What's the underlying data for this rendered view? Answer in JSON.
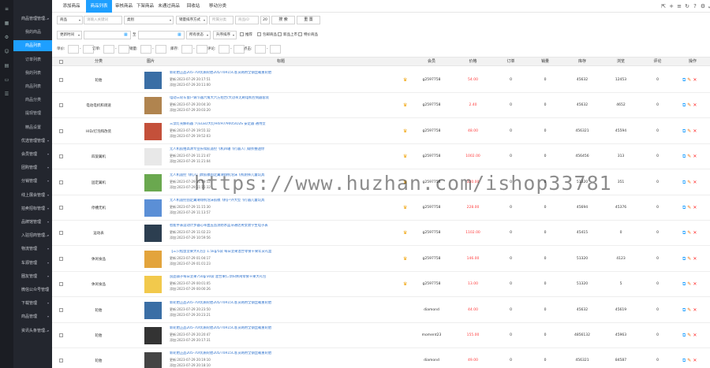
{
  "app": {
    "title": "商品列表"
  },
  "sidebar": {
    "icons": [
      "menu-icon",
      "grid-icon",
      "gear-icon",
      "user-icon",
      "chart-icon",
      "folder-icon",
      "list-icon"
    ],
    "items": [
      {
        "label": "商品管理管理...",
        "sub": false,
        "arrow": true
      },
      {
        "label": "我的商品",
        "sub": true
      },
      {
        "label": "商品列表",
        "sub": true,
        "active": true
      },
      {
        "label": "订单列表",
        "sub": true
      },
      {
        "label": "我的列表",
        "sub": true
      },
      {
        "label": "商品列表",
        "sub": true
      },
      {
        "label": "商品分类",
        "sub": true
      },
      {
        "label": "提现管理",
        "sub": true
      },
      {
        "label": "精品设置",
        "sub": true
      },
      {
        "label": "优选管理管理",
        "sub": false,
        "arrow": true
      },
      {
        "label": "会员管理",
        "sub": false,
        "arrow": true
      },
      {
        "label": "团购管理",
        "sub": false,
        "arrow": true
      },
      {
        "label": "分销管理",
        "sub": false,
        "arrow": true
      },
      {
        "label": "线上展会管理",
        "sub": false,
        "arrow": true
      },
      {
        "label": "拍卖招标管理",
        "sub": false,
        "arrow": true
      },
      {
        "label": "品牌馆管理",
        "sub": false,
        "arrow": true
      },
      {
        "label": "入驻招商管理...",
        "sub": false,
        "arrow": true
      },
      {
        "label": "物流管理",
        "sub": false,
        "arrow": true
      },
      {
        "label": "车源管理",
        "sub": false,
        "arrow": true
      },
      {
        "label": "圈友管理",
        "sub": false,
        "arrow": true
      },
      {
        "label": "微信公众号管理",
        "sub": false,
        "arrow": true
      },
      {
        "label": "下载管理",
        "sub": false,
        "arrow": true
      },
      {
        "label": "商品管理",
        "sub": false,
        "arrow": true
      },
      {
        "label": "资讯头条管理...",
        "sub": false,
        "arrow": true
      }
    ]
  },
  "tabs": [
    {
      "label": "添加商品",
      "active": false
    },
    {
      "label": "商品列表",
      "active": true
    },
    {
      "label": "审核商品",
      "active": false
    },
    {
      "label": "下架商品",
      "active": false
    },
    {
      "label": "未通过商品",
      "active": false
    },
    {
      "label": "回收站",
      "active": false
    },
    {
      "label": "移动分类",
      "active": false
    }
  ],
  "toolbar_icons": [
    "expand-icon",
    "add-icon",
    "list-icon",
    "refresh-icon",
    "help-icon",
    "settings-icon",
    "fullscreen-icon"
  ],
  "filters": {
    "row1": {
      "field_select": "商品",
      "keyword_placeholder": "请输入关键词",
      "type_select": "类别",
      "sort_select": "销量排序方式",
      "category_placeholder": "所属分类",
      "sub_placeholder": "商品ID",
      "page_size": "20",
      "search_button": "搜 索",
      "reset_button": "重 置"
    },
    "row2": {
      "time_select": "更新时间",
      "to_label": "至",
      "status_select": "所有状态",
      "order_select": "升序排序",
      "checkboxes": [
        "推荐",
        "包邮商品",
        "新品上市",
        "特价商品"
      ]
    },
    "row3": {
      "labels": [
        "单价:",
        "订单:",
        "销量:",
        "库存:",
        "评论:",
        "点击:"
      ],
      "dash": "-"
    }
  },
  "table": {
    "headers": [
      "",
      "分类",
      "",
      "图片",
      "标题",
      "",
      "会员",
      "价格",
      "订单",
      "销量",
      "库存",
      "浏览",
      "评论",
      "操作"
    ],
    "rows": [
      {
        "category": "轮胎",
        "title": "新轮胎正品205-70/优质轮胎205/70R15C客货两用全钢丝载重轮胎",
        "updated": "更新:2023-07-29 20:17:51",
        "added": "添加:2023-07-29 20:11:00",
        "member": "g2597758",
        "price": "54.00",
        "orders": "0",
        "sales": "0",
        "stock": "45632",
        "views": "12453",
        "comments": "0",
        "thumb": "#3a6ea5",
        "vip": true
      },
      {
        "category": "电动电机和调速",
        "title": "电动三轮车窗户调节器六角大六方组合/大功率无刷电机控制器套装",
        "updated": "更新:2023-07-29 20:04:30",
        "added": "添加:2023-07-29 20:03:20",
        "member": "g2597758",
        "price": "2.40",
        "orders": "0",
        "sales": "0",
        "stock": "45632",
        "views": "4652",
        "comments": "0",
        "thumb": "#b0844f",
        "vip": true
      },
      {
        "category": "HID/灯泡和改装",
        "title": "三漂灯光解码器 汽车LED大灯H4/H7/9005/D2S 安定器 通用型",
        "updated": "更新:2023-07-29 19:55:32",
        "added": "添加:2023-07-29 19:52:03",
        "member": "g2597758",
        "price": "48.00",
        "orders": "0",
        "sales": "0",
        "stock": "456321",
        "views": "45594",
        "comments": "0",
        "thumb": "#c4503a",
        "vip": true
      },
      {
        "category": "四旋翼机",
        "title": "无人机航拍高清专业长续航遥控飞机四轴飞行器入门级折叠迷你",
        "updated": "更新:2023-07-29 11:21:47",
        "added": "添加:2023-07-29 11:21:04",
        "member": "g2597758",
        "price": "1002.00",
        "orders": "0",
        "sales": "0",
        "stock": "456456",
        "views": "313",
        "comments": "0",
        "thumb": "#e8e8e8",
        "vip": true
      },
      {
        "category": "固定翼机",
        "title": "无人机遥控飞机入门款航模固定翼滑翔机泡沫飞机耐摔儿童玩具",
        "updated": "更新:2023-07-29 11:19:52",
        "added": "添加:2023-07-29 11:15:32",
        "member": "g2597758",
        "price": "320.00",
        "orders": "0",
        "sales": "0",
        "stock": "51320",
        "views": "351",
        "comments": "0",
        "thumb": "#6aa84f",
        "vip": true
      },
      {
        "category": "停槽无机",
        "title": "无人机遥控固定翼滑翔机泡沫航模飞机户外大型飞行器儿童玩具",
        "updated": "更新:2023-07-29 11:15:30",
        "added": "添加:2023-07-29 11:13:57",
        "member": "g2597758",
        "price": "228.00",
        "orders": "0",
        "sales": "0",
        "stock": "45694",
        "views": "45376",
        "comments": "0",
        "thumb": "#5b8fd6",
        "vip": true
      },
      {
        "category": "运动表",
        "title": "智能手表运动计步器心率血压监测防水蓝牙通话男女款学生电子表",
        "updated": "更新:2023-07-29 11:02:23",
        "added": "添加:2023-07-29 10:59:56",
        "member": "g2597758",
        "price": "1102.00",
        "orders": "0",
        "sales": "0",
        "stock": "45415",
        "views": "0",
        "comments": "0",
        "thumb": "#2c3e50",
        "vip": true
      },
      {
        "category": "休闲食品",
        "title": "【三只松鼠坚果大礼包】1.5kg/5袋 每日坚果混合零食干果年货礼盒",
        "updated": "更新:2023-07-29 01:04:17",
        "added": "添加:2023-07-29 01:01:23",
        "member": "g2597758",
        "price": "146.00",
        "orders": "0",
        "sales": "0",
        "stock": "51320",
        "views": "4123",
        "comments": "0",
        "thumb": "#e3a43c",
        "vip": true
      },
      {
        "category": "休闲食品",
        "title": "良品铺子每日坚果750g/30袋 混合果仁孕妇休闲零食干果大礼包",
        "updated": "更新:2023-07-29 00:01:05",
        "added": "添加:2023-07-29 00:00:26",
        "member": "g2597758",
        "price": "13.00",
        "orders": "0",
        "sales": "0",
        "stock": "51320",
        "views": "5",
        "comments": "0",
        "thumb": "#f2c94c",
        "vip": true
      },
      {
        "category": "轮胎",
        "title": "新轮胎正品205-70/优质轮胎205/70R15C客货两用全钢丝载重轮胎",
        "updated": "更新:2023-07-29 20:23:50",
        "added": "添加:2023-07-29 20:23:21",
        "member": "diamond",
        "price": "44.00",
        "orders": "0",
        "sales": "0",
        "stock": "45632",
        "views": "45619",
        "comments": "0",
        "thumb": "#3a6ea5",
        "vip": false
      },
      {
        "category": "轮胎",
        "title": "新轮胎正品205-70/优质轮胎205/70R15C客货两用全钢丝载重轮胎",
        "updated": "更新:2023-07-29 20:20:47",
        "added": "添加:2023-07-29 20:17:31",
        "member": "moment23",
        "price": "155.00",
        "orders": "0",
        "sales": "0",
        "stock": "4856132",
        "views": "45963",
        "comments": "0",
        "thumb": "#333333",
        "vip": false
      },
      {
        "category": "轮胎",
        "title": "新轮胎正品205-70/优质轮胎205/70R15C客货两用全钢丝载重轮胎",
        "updated": "更新:2023-07-29 20:19:10",
        "added": "添加:2023-07-29 20:18:10",
        "member": "diamond",
        "price": "49.00",
        "orders": "0",
        "sales": "0",
        "stock": "456321",
        "views": "84587",
        "comments": "0",
        "thumb": "#444444",
        "vip": false
      }
    ]
  },
  "watermark": "https://www.huzhan.com/ishop33781"
}
